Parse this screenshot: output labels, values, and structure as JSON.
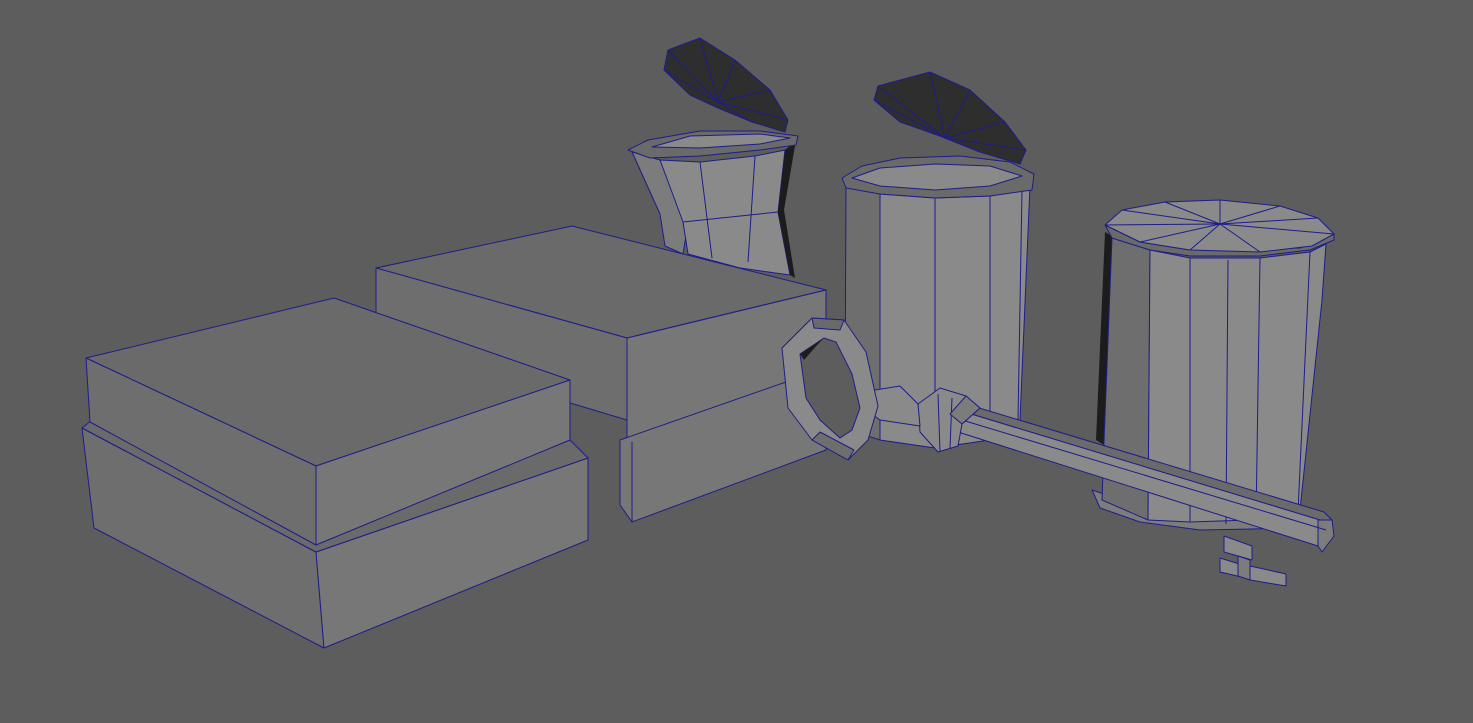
{
  "viewport": {
    "background": "#5d5d5d",
    "wireframe_color": "#1d1d8a",
    "objects": [
      "box-left",
      "box-right",
      "jar-small-open",
      "jar-middle-open",
      "jar-right-closed",
      "key"
    ]
  }
}
